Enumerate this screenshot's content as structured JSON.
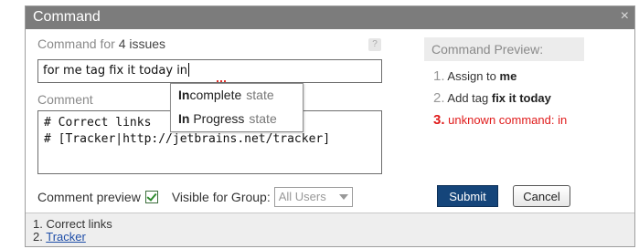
{
  "window": {
    "title": "Command",
    "close_icon": "×"
  },
  "command": {
    "label_prefix": "Command for",
    "issue_count": "4 issues",
    "help_icon": "?",
    "input_value": "for me tag fix it today in"
  },
  "suggestions": [
    {
      "match": "In",
      "rest": "complete",
      "kind": "state"
    },
    {
      "match": "In",
      "rest": " Progress",
      "kind": "state"
    }
  ],
  "comment": {
    "label": "Comment",
    "text": "# Correct links\n# [Tracker|http://jetbrains.net/tracker]"
  },
  "options": {
    "comment_preview_label": "Comment preview",
    "comment_preview_checked": true,
    "visible_group_label": "Visible for Group:",
    "visible_group_value": "All Users"
  },
  "preview": {
    "heading": "Command Preview:",
    "items": [
      {
        "num": "1.",
        "text": "Assign to ",
        "bold": "me"
      },
      {
        "num": "2.",
        "text": "Add tag ",
        "bold": "fix it today"
      },
      {
        "num": "3.",
        "text": "unknown command: in",
        "bold": ""
      }
    ],
    "error_color": "#e01b1b"
  },
  "buttons": {
    "submit": "Submit",
    "cancel": "Cancel"
  },
  "footer": {
    "line1": "1. Correct links",
    "line2_num": "2.",
    "line2_link": "Tracker"
  }
}
